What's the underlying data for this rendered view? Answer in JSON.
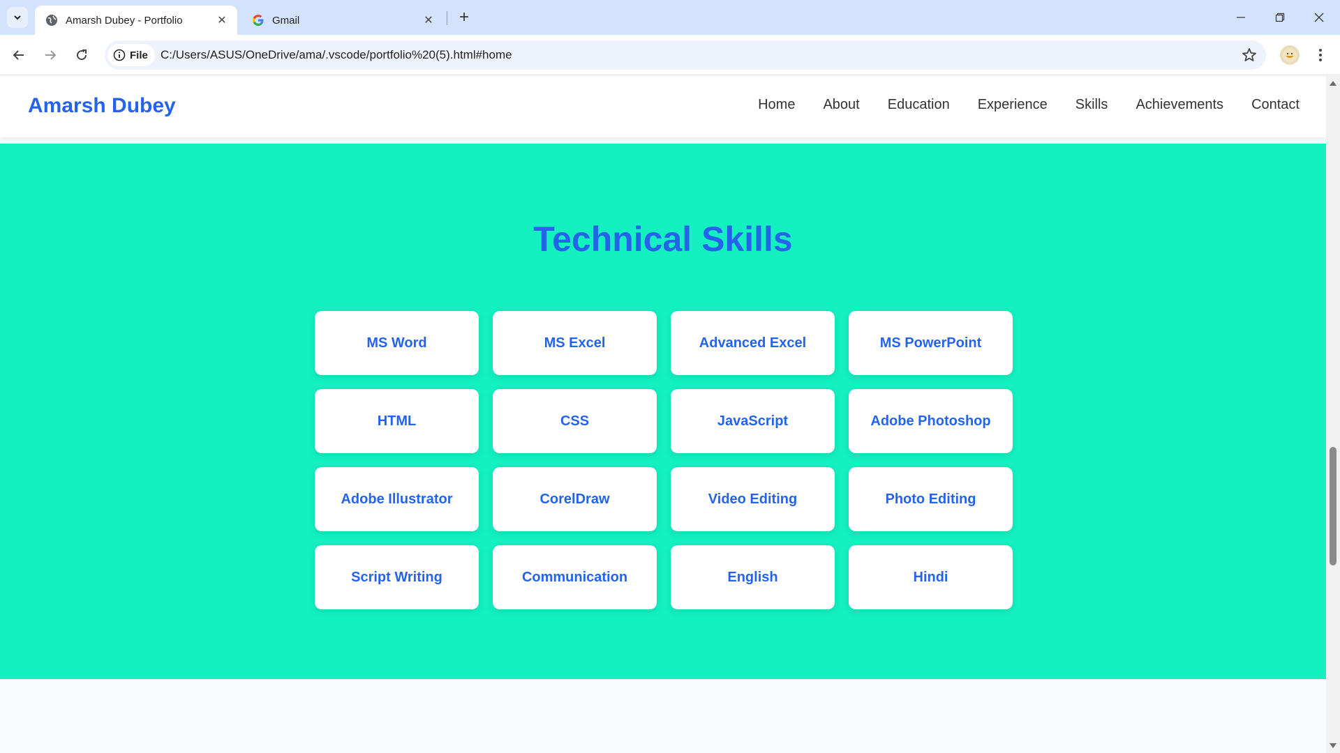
{
  "browser": {
    "tabs": [
      {
        "title": "Amarsh Dubey - Portfolio",
        "icon": "globe-icon",
        "active": true
      },
      {
        "title": "Gmail",
        "icon": "google-icon",
        "active": false
      }
    ],
    "address": {
      "chip_label": "File",
      "url": "C:/Users/ASUS/OneDrive/ama/.vscode/portfolio%20(5).html#home"
    }
  },
  "site": {
    "brand": "Amarsh Dubey",
    "nav": [
      "Home",
      "About",
      "Education",
      "Experience",
      "Skills",
      "Achievements",
      "Contact"
    ]
  },
  "skills": {
    "title": "Technical Skills",
    "items": [
      "MS Word",
      "MS Excel",
      "Advanced Excel",
      "MS PowerPoint",
      "HTML",
      "CSS",
      "JavaScript",
      "Adobe Photoshop",
      "Adobe Illustrator",
      "CorelDraw",
      "Video Editing",
      "Photo Editing",
      "Script Writing",
      "Communication",
      "English",
      "Hindi"
    ]
  },
  "colors": {
    "accent": "#2563eb",
    "section_bg": "#14f0c0",
    "tabbar_bg": "#d3e3fd"
  }
}
